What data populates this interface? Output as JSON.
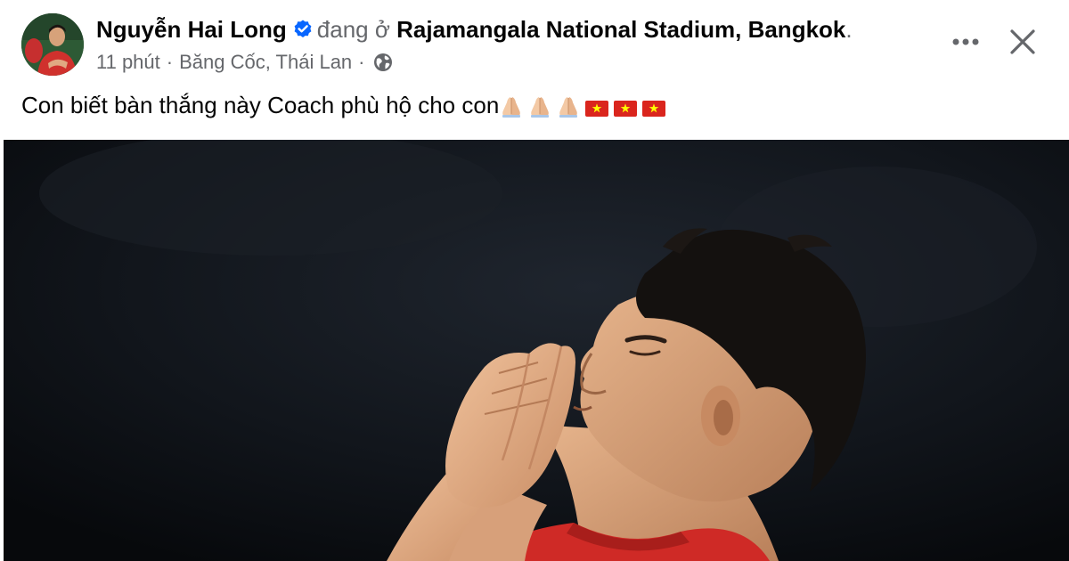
{
  "post": {
    "author_name": "Nguyễn Hai Long",
    "checkin_prefix": "đang ở",
    "location": "Rajamangala National Stadium, Bangkok",
    "location_suffix": ".",
    "time": "11 phút",
    "meta_separator": "·",
    "place": "Băng Cốc, Thái Lan",
    "caption_text": "Con biết bàn thắng này Coach phù hộ cho con",
    "caption_emojis": [
      "folded-hands",
      "folded-hands",
      "folded-hands",
      "vietnam-flag",
      "vietnam-flag",
      "vietnam-flag"
    ],
    "audience_icon": "globe-icon",
    "photo_subject": "football-player-praying"
  },
  "colors": {
    "verified_blue": "#0866ff",
    "secondary_text": "#65676b",
    "primary_text": "#050505",
    "flag_red": "#da251d",
    "flag_star": "#ffff00"
  }
}
